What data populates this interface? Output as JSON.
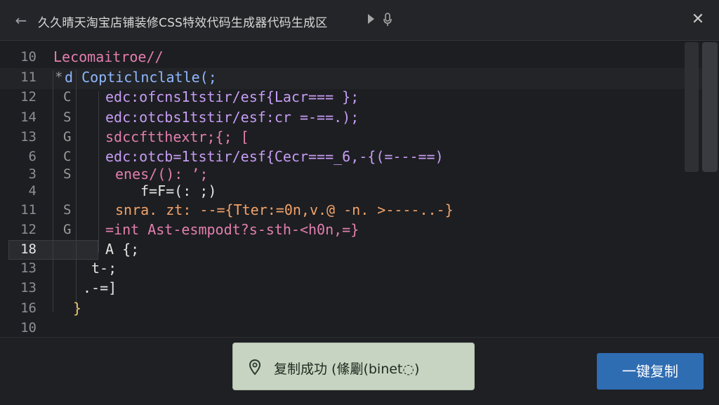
{
  "window": {
    "title": "久久晴天淘宝店铺装修CSS特效代码生成器代码生成区",
    "back_icon": "back-arrow-icon",
    "play_icon": "play-icon",
    "mic_icon": "microphone-icon",
    "close_icon": "close-icon",
    "close_glyph": "✕",
    "back_glyph": "←"
  },
  "editor": {
    "line_numbers": [
      "10",
      "11",
      "12",
      "14",
      "13",
      "6",
      "3",
      "4",
      "11",
      "12",
      "18",
      "13",
      "13",
      "16",
      "10"
    ],
    "markers": [
      "",
      "*",
      "C",
      "S",
      "G",
      "C",
      "S",
      "",
      "S",
      "G",
      "",
      "",
      "",
      "",
      ""
    ],
    "lines": [
      "Lecomaitroe//",
      "d Copticlnclatle(;",
      "edc:ofcns1tstir/esf{Lacr=== };",
      "edc:otcbs1tstir/esf:cr =-==.);",
      "sdccftthextr;{; [",
      "edc:otcb=1tstir/esf{Cecr===_6,-{(=---==)",
      "enes/(): ʼ;",
      "f=F=(: ;)",
      "snra. zt: --={Tter:=0n,v.@ -n. >----..-}",
      "=int Ast-esmpodt?s-sth-<h0n,=}",
      "A {;",
      "t-;",
      ".-=]",
      "}",
      ""
    ]
  },
  "toast": {
    "icon": "location-pin-icon",
    "text": "复制成功 (絛劚(binet◌)"
  },
  "copy_button": {
    "label": "一键复制"
  },
  "colors": {
    "accent": "#2f6db3",
    "toast_bg": "#c7d4c2",
    "background": "#1c1d20"
  }
}
